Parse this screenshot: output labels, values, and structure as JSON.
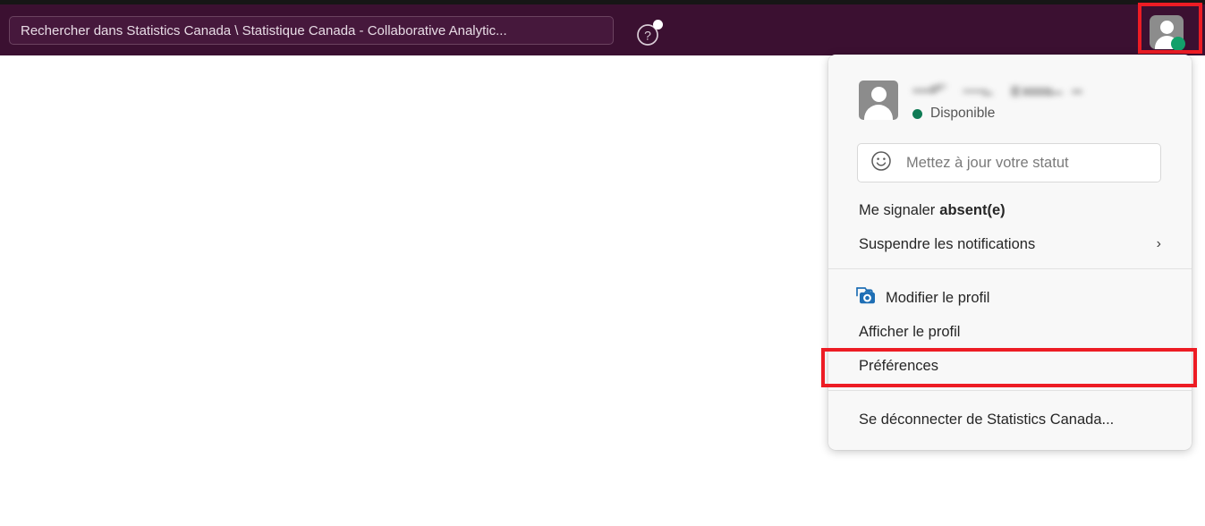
{
  "header": {
    "search": {
      "value": "Rechercher dans Statistics Canada \\ Statistique Canada - Collaborative Analytic...",
      "icon": "search-icon"
    },
    "help": {
      "icon": "help-question-icon",
      "badge": true
    },
    "avatar": {
      "icon": "user-avatar-icon",
      "presence_color": "#13a06a",
      "presence_state": "available"
    },
    "colors": {
      "header_bg": "#3b1031",
      "top_strip": "#161616",
      "annotation": "#ed1c24"
    }
  },
  "subbar": {
    "favorite_icon": "star-outline-icon",
    "status_dot_icon": "circle-icon"
  },
  "account_menu": {
    "profile": {
      "avatar_icon": "user-avatar-icon",
      "name": "",
      "presence_label": "Disponible",
      "presence_color": "#0f7b55"
    },
    "status_field": {
      "icon": "smiley-icon",
      "placeholder": "Mettez à jour votre statut",
      "value": ""
    },
    "items": [
      {
        "label_prefix": "Me signaler",
        "label_bold": "absent(e)",
        "name": "set-away"
      },
      {
        "label": "Suspendre les notifications",
        "name": "pause-notifications",
        "chevron": "chevron-right-icon"
      },
      {
        "label": "Modifier le profil",
        "name": "edit-profile",
        "icon": "camera-icon"
      },
      {
        "label": "Afficher le profil",
        "name": "view-profile"
      },
      {
        "label": "Préférences",
        "name": "preferences",
        "highlighted": true
      },
      {
        "label": "Se déconnecter de Statistics Canada...",
        "name": "sign-out"
      }
    ]
  }
}
